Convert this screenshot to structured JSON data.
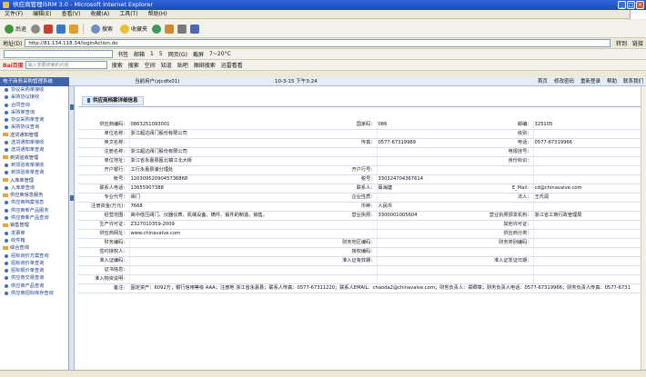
{
  "window": {
    "title": "供应商管理iSRM 3.0 - Microsoft Internet Explorer",
    "buttons": [
      "_",
      "□",
      "×"
    ]
  },
  "menu": [
    "文件(F)",
    "编辑(E)",
    "查看(V)",
    "收藏(A)",
    "工具(T)",
    "帮助(H)"
  ],
  "toolbar": {
    "back": "后退",
    "search": "搜索",
    "favorites": "收藏夹",
    "address_label": "地址(D)",
    "address": "http://81.134.118.34/loginAction.do",
    "go": "转到",
    "links": "链接"
  },
  "toolbar2": {
    "items": [
      "书签",
      "邮箱",
      "1",
      "5",
      "网页(G)",
      "截屏",
      "7~20°C"
    ]
  },
  "toolbar3": {
    "baidu": "Bai百度",
    "search_placeholder": "输入想要搜索的内容",
    "items": [
      "搜索",
      "搜索",
      "空间",
      "知道",
      "贴吧",
      "捆绑搜索",
      "迅雷看看"
    ]
  },
  "app": {
    "sidebar_title": "电子商务采购管理系统",
    "user": "当前用户(zjcdfx01)",
    "time": "10-3-15 下午3:24",
    "nav": [
      "首页",
      "修改密码",
      "重新登录",
      "帮助",
      "联系我们"
    ]
  },
  "sidebar": [
    {
      "type": "item",
      "label": "协议采购单接收"
    },
    {
      "type": "item",
      "label": "采购协议接收"
    },
    {
      "type": "item",
      "label": "合同查询"
    },
    {
      "type": "item",
      "label": "采购单查询"
    },
    {
      "type": "item",
      "label": "协议采购单查询"
    },
    {
      "type": "item",
      "label": "采购协议查询"
    },
    {
      "type": "group",
      "label": "送货通知管理"
    },
    {
      "type": "item",
      "label": "送货通知单接收"
    },
    {
      "type": "item",
      "label": "送货通知单查询"
    },
    {
      "type": "group",
      "label": "到货验收管理"
    },
    {
      "type": "item",
      "label": "到货验收单接收"
    },
    {
      "type": "item",
      "label": "到货验收单查询"
    },
    {
      "type": "group",
      "label": "入库单管理"
    },
    {
      "type": "item",
      "label": "入库单查询"
    },
    {
      "type": "group",
      "label": "供应商信息服务"
    },
    {
      "type": "item",
      "label": "供应商档案信息"
    },
    {
      "type": "item",
      "label": "供应商新产品服务"
    },
    {
      "type": "item",
      "label": "供应商新产品查询"
    },
    {
      "type": "group",
      "label": "销售管理"
    },
    {
      "type": "item",
      "label": "发票单"
    },
    {
      "type": "item",
      "label": "收件箱"
    },
    {
      "type": "group",
      "label": "综合查询"
    },
    {
      "type": "item",
      "label": "招标询价方案查询"
    },
    {
      "type": "item",
      "label": "招标询价单查询"
    },
    {
      "type": "item",
      "label": "招标报价单查询"
    },
    {
      "type": "item",
      "label": "供应商交易查询"
    },
    {
      "type": "item",
      "label": "供应商产品查询"
    },
    {
      "type": "item",
      "label": "供应商招标库存查询"
    }
  ],
  "page": {
    "breadcrumb": "供应商档案详细信息"
  },
  "form": [
    [
      [
        "供应商编码：",
        "0863251093001"
      ],
      [
        "国家码：",
        "086"
      ],
      [
        "邮编：",
        "325105"
      ]
    ],
    [
      [
        "单位名称：",
        "浙江超达阀门股份有限公司"
      ],
      [
        "",
        ""
      ],
      [
        "级别：",
        ""
      ]
    ],
    [
      [
        "英文名称：",
        ""
      ],
      [
        "传真：",
        "0577-67319989"
      ],
      [
        "电话：",
        "0577-67319966"
      ]
    ],
    [
      [
        "注册名称：",
        "浙江超达阀门股份有限公司"
      ],
      [
        "",
        ""
      ],
      [
        "电报挂号：",
        ""
      ]
    ],
    [
      [
        "单位地址：",
        "浙江省永嘉县瓯北镇江北大街"
      ],
      [
        "",
        ""
      ],
      [
        "身份标识：",
        ""
      ]
    ],
    [
      [
        "开户银行：",
        "工行永嘉县浦分理处"
      ],
      [
        "开户行号：",
        ""
      ],
      [
        "",
        ""
      ]
    ],
    [
      [
        "帐号：",
        "1203095209045736868"
      ],
      [
        "税号：",
        "330324704367614"
      ],
      [
        "",
        ""
      ]
    ],
    [
      [
        "联系人电话：",
        "13655907388"
      ],
      [
        "联系人：",
        "蔡海建"
      ],
      [
        "E_Mail：",
        "cd@chinavalve.com"
      ]
    ],
    [
      [
        "专业代号：",
        "阀门"
      ],
      [
        "企业性质：",
        ""
      ],
      [
        "法人：",
        "王氏润"
      ]
    ],
    [
      [
        "注册资金(万元)：",
        "7668"
      ],
      [
        "币种：",
        "人民币"
      ],
      [
        "",
        ""
      ]
    ],
    [
      [
        "经营范围：",
        "高中低压阀门、仪器仪表、机械设备、铸件、锻件的制造、销售。"
      ],
      [
        "营业执照：",
        "3300001005604"
      ],
      [
        "营业执照颁发机构：",
        "浙江省工商行政管理局"
      ]
    ],
    [
      [
        "生产许可证：",
        "Z327010359-2009"
      ],
      [
        "",
        ""
      ],
      [
        "其他许可证：",
        ""
      ]
    ],
    [
      [
        "供应商网址：",
        "www.chinavalve.com"
      ],
      [
        "",
        ""
      ],
      [
        "供应商分类：",
        ""
      ]
    ],
    [
      [
        "财务编码：",
        ""
      ],
      [
        "财务地区编码：",
        ""
      ],
      [
        "财务类别编码：",
        ""
      ]
    ],
    [
      [
        "签约授权人：",
        ""
      ],
      [
        "授权编码：",
        ""
      ],
      [
        "",
        ""
      ]
    ],
    [
      [
        "准入证编码：",
        ""
      ],
      [
        "准入证有效期：",
        ""
      ],
      [
        "准入证发证日期：",
        ""
      ]
    ],
    [
      [
        "证书信息：",
        ""
      ],
      [
        "",
        ""
      ],
      [
        "",
        ""
      ]
    ],
    [
      [
        "准入物资说明：",
        ""
      ],
      [
        "",
        ""
      ],
      [
        "",
        ""
      ]
    ],
    [
      [
        "备注：",
        "固定资产：6092万；银行信用等级 AAA；注册地 浙江省永嘉县；联系人传真：0577-67311220；联系人EMAIL：chaoda2@chinavalve.com；财务负责人：郑卿章；财务负责人电话：0577-67319966；财务负责人传真：0577-6731"
      ]
    ]
  ],
  "colors": {
    "title": "#1d4bbd",
    "sidebar_head": "#3f64a8",
    "link": "#1f3f8a"
  }
}
